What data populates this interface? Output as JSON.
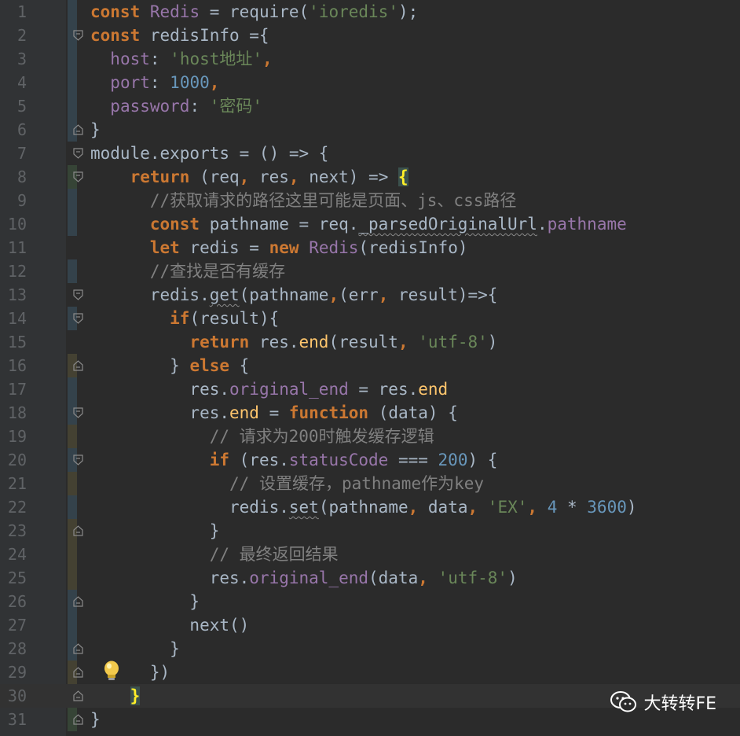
{
  "editor": {
    "theme_colors": {
      "keyword": "#cc7832",
      "string": "#6a8759",
      "number": "#6897bb",
      "property": "#9876aa",
      "comment": "#808080",
      "function": "#ffc66d",
      "text": "#a9b7c6",
      "background": "#2b2b2b"
    },
    "current_line": 30,
    "lines": [
      {
        "n": "1"
      },
      {
        "n": "2"
      },
      {
        "n": "3"
      },
      {
        "n": "4"
      },
      {
        "n": "5"
      },
      {
        "n": "6"
      },
      {
        "n": "7"
      },
      {
        "n": "8"
      },
      {
        "n": "9"
      },
      {
        "n": "10"
      },
      {
        "n": "11"
      },
      {
        "n": "12"
      },
      {
        "n": "13"
      },
      {
        "n": "14"
      },
      {
        "n": "15"
      },
      {
        "n": "16"
      },
      {
        "n": "17"
      },
      {
        "n": "18"
      },
      {
        "n": "19"
      },
      {
        "n": "20"
      },
      {
        "n": "21"
      },
      {
        "n": "22"
      },
      {
        "n": "23"
      },
      {
        "n": "24"
      },
      {
        "n": "25"
      },
      {
        "n": "26"
      },
      {
        "n": "27"
      },
      {
        "n": "28"
      },
      {
        "n": "29"
      },
      {
        "n": "30"
      },
      {
        "n": "31"
      }
    ],
    "code": {
      "l1": [
        [
          "kw",
          "const"
        ],
        [
          "plain",
          " "
        ],
        [
          "prop",
          "Redis"
        ],
        [
          "plain",
          " = require("
        ],
        [
          "str",
          "'ioredis'"
        ],
        [
          "plain",
          ");"
        ]
      ],
      "l2": [
        [
          "kw",
          "const"
        ],
        [
          "plain",
          " redisInfo ={"
        ]
      ],
      "l3": [
        [
          "plain",
          "  "
        ],
        [
          "prop",
          "host"
        ],
        [
          "plain",
          ": "
        ],
        [
          "str",
          "'host地址'"
        ],
        [
          "kw",
          ","
        ]
      ],
      "l4": [
        [
          "plain",
          "  "
        ],
        [
          "prop",
          "port"
        ],
        [
          "plain",
          ": "
        ],
        [
          "num",
          "1000"
        ],
        [
          "kw",
          ","
        ]
      ],
      "l5": [
        [
          "plain",
          "  "
        ],
        [
          "prop",
          "password"
        ],
        [
          "plain",
          ": "
        ],
        [
          "str",
          "'密码'"
        ]
      ],
      "l6": [
        [
          "plain",
          "}"
        ]
      ],
      "l7": [
        [
          "plain",
          "module.exports = () => {"
        ]
      ],
      "l8": [
        [
          "plain",
          "    "
        ],
        [
          "kw",
          "return"
        ],
        [
          "plain",
          " (req"
        ],
        [
          "kw",
          ","
        ],
        [
          "plain",
          " res"
        ],
        [
          "kw",
          ","
        ],
        [
          "plain",
          " next) => "
        ],
        [
          "brace",
          "{"
        ]
      ],
      "l9": [
        [
          "plain",
          "      "
        ],
        [
          "cmt",
          "//获取请求的路径这里可能是页面、js、css路径"
        ]
      ],
      "l10": [
        [
          "plain",
          "      "
        ],
        [
          "kw",
          "const"
        ],
        [
          "plain",
          " pathname = req."
        ],
        [
          "squig",
          "_parsedOriginalUrl"
        ],
        [
          "plain",
          "."
        ],
        [
          "prop",
          "pathname"
        ]
      ],
      "l11": [
        [
          "plain",
          "      "
        ],
        [
          "kw",
          "let"
        ],
        [
          "plain",
          " redis = "
        ],
        [
          "kw",
          "new"
        ],
        [
          "plain",
          " "
        ],
        [
          "prop",
          "Redis"
        ],
        [
          "plain",
          "(redisInfo)"
        ]
      ],
      "l12": [
        [
          "plain",
          "      "
        ],
        [
          "cmt",
          "//查找是否有缓存"
        ]
      ],
      "l13": [
        [
          "plain",
          "      redis."
        ],
        [
          "squig",
          "get"
        ],
        [
          "plain",
          "(pathname"
        ],
        [
          "kw",
          ","
        ],
        [
          "plain",
          "(err"
        ],
        [
          "kw",
          ","
        ],
        [
          "plain",
          " result)=>{"
        ]
      ],
      "l14": [
        [
          "plain",
          "        "
        ],
        [
          "kw",
          "if"
        ],
        [
          "plain",
          "(result){"
        ]
      ],
      "l15": [
        [
          "plain",
          "          "
        ],
        [
          "kw",
          "return"
        ],
        [
          "plain",
          " res."
        ],
        [
          "fn",
          "end"
        ],
        [
          "plain",
          "(result"
        ],
        [
          "kw",
          ","
        ],
        [
          "plain",
          " "
        ],
        [
          "str",
          "'utf-8'"
        ],
        [
          "plain",
          ")"
        ]
      ],
      "l16": [
        [
          "plain",
          "        } "
        ],
        [
          "kw",
          "else"
        ],
        [
          "plain",
          " {"
        ]
      ],
      "l17": [
        [
          "plain",
          "          res."
        ],
        [
          "prop",
          "original_end"
        ],
        [
          "plain",
          " = res."
        ],
        [
          "fn",
          "end"
        ]
      ],
      "l18": [
        [
          "plain",
          "          res."
        ],
        [
          "fn",
          "end"
        ],
        [
          "plain",
          " = "
        ],
        [
          "kw",
          "function"
        ],
        [
          "plain",
          " (data) {"
        ]
      ],
      "l19": [
        [
          "plain",
          "            "
        ],
        [
          "cmt",
          "// 请求为200时触发缓存逻辑"
        ]
      ],
      "l20": [
        [
          "plain",
          "            "
        ],
        [
          "kw",
          "if"
        ],
        [
          "plain",
          " (res."
        ],
        [
          "prop",
          "statusCode"
        ],
        [
          "plain",
          " === "
        ],
        [
          "num",
          "200"
        ],
        [
          "plain",
          ") {"
        ]
      ],
      "l21": [
        [
          "plain",
          "              "
        ],
        [
          "cmt",
          "// 设置缓存，pathname作为key"
        ]
      ],
      "l22": [
        [
          "plain",
          "              redis."
        ],
        [
          "squig",
          "set"
        ],
        [
          "plain",
          "(pathname"
        ],
        [
          "kw",
          ","
        ],
        [
          "plain",
          " data"
        ],
        [
          "kw",
          ","
        ],
        [
          "plain",
          " "
        ],
        [
          "str",
          "'EX'"
        ],
        [
          "kw",
          ","
        ],
        [
          "plain",
          " "
        ],
        [
          "num",
          "4"
        ],
        [
          "plain",
          " * "
        ],
        [
          "num",
          "3600"
        ],
        [
          "plain",
          ")"
        ]
      ],
      "l23": [
        [
          "plain",
          "            }"
        ]
      ],
      "l24": [
        [
          "plain",
          "            "
        ],
        [
          "cmt",
          "// 最终返回结果"
        ]
      ],
      "l25": [
        [
          "plain",
          "            res."
        ],
        [
          "prop",
          "original_end"
        ],
        [
          "plain",
          "(data"
        ],
        [
          "kw",
          ","
        ],
        [
          "plain",
          " "
        ],
        [
          "str",
          "'utf-8'"
        ],
        [
          "plain",
          ")"
        ]
      ],
      "l26": [
        [
          "plain",
          "          }"
        ]
      ],
      "l27": [
        [
          "plain",
          "          next()"
        ]
      ],
      "l28": [
        [
          "plain",
          "        }"
        ]
      ],
      "l29": [
        [
          "plain",
          "      })"
        ]
      ],
      "l30": [
        [
          "plain",
          "    "
        ],
        [
          "brace",
          "}"
        ]
      ],
      "l31": [
        [
          "plain",
          "}"
        ]
      ]
    }
  },
  "watermark": {
    "icon": "wechat-icon",
    "text": "大转转FE"
  }
}
